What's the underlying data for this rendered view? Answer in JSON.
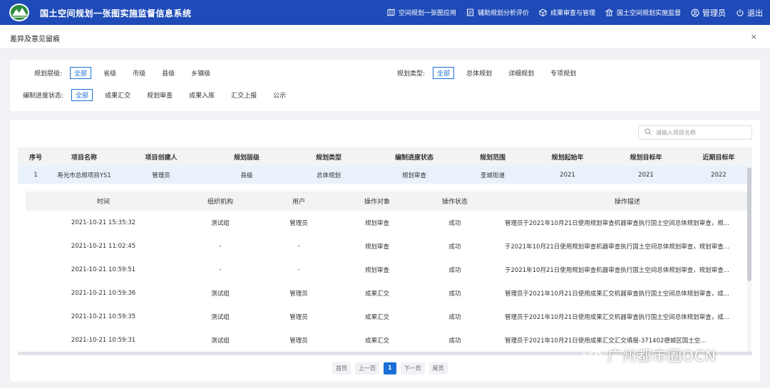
{
  "app": {
    "title": "国土空间规划一张图实施监督信息系统",
    "nav": [
      {
        "label": "空间规划一张图应用",
        "icon": "map-icon"
      },
      {
        "label": "辅助规划分析评价",
        "icon": "document-icon"
      },
      {
        "label": "成果审查与管理",
        "icon": "cube-icon"
      },
      {
        "label": "国土空间规划实施监督",
        "icon": "bank-icon"
      }
    ],
    "user_label": "管理员",
    "logout_label": "退出"
  },
  "panel": {
    "title": "差异及意见留痕",
    "close_label": "×"
  },
  "filters": {
    "level_label": "规划层级:",
    "level_options": [
      "全部",
      "省级",
      "市级",
      "县级",
      "乡镇级"
    ],
    "type_label": "规划类型:",
    "type_options": [
      "全部",
      "总体规划",
      "详细规划",
      "专项规划"
    ],
    "progress_label": "编制进度状态:",
    "progress_options": [
      "全部",
      "成果汇交",
      "规划审查",
      "成果入库",
      "汇交上报",
      "公示"
    ]
  },
  "search": {
    "placeholder": "请输入项目名称"
  },
  "main_table": {
    "columns": [
      "序号",
      "项目名称",
      "项目创建人",
      "规划层级",
      "规划类型",
      "编制进度状态",
      "规划范围",
      "规划起始年",
      "规划目标年",
      "近期目标年"
    ],
    "rows": [
      [
        "1",
        "寿光市总规项目YS1",
        "管理员",
        "县级",
        "总体规划",
        "规划审查",
        "圣城街道",
        "2021",
        "2021",
        "2022"
      ]
    ]
  },
  "sub_table": {
    "columns": [
      "时间",
      "组织机构",
      "用户",
      "操作对象",
      "操作状态",
      "操作描述"
    ],
    "rows": [
      [
        "2021-10-21 15:35:32",
        "测试组",
        "管理员",
        "规划审查",
        "成功",
        "管理员于2021年10月21日使用规划审查机器审查执行国土空间总体规划审查，规..."
      ],
      [
        "2021-10-21 11:02:45",
        "-",
        "-",
        "规划审查",
        "成功",
        "于2021年10月21日使用规划审查机器审查执行国土空间总体规划审查，规划审查..."
      ],
      [
        "2021-10-21 10:59:51",
        "-",
        "-",
        "规划审查",
        "成功",
        "于2021年10月21日使用规划审查机器审查执行国土空间总体规划审查，规划审查..."
      ],
      [
        "2021-10-21 10:59:36",
        "测试组",
        "管理员",
        "成果汇交",
        "成功",
        "管理员于2021年10月21日使用成果汇交机器审查执行国土空间总体规划审查，成..."
      ],
      [
        "2021-10-21 10:59:35",
        "测试组",
        "管理员",
        "成果汇交",
        "成功",
        "管理员于2021年10月21日使用成果汇交机器审查执行国土空间总体规划审查，成..."
      ],
      [
        "2021-10-21 10:59:31",
        "测试组",
        "管理员",
        "成果汇交",
        "成功",
        "管理员于2021年10月21日使用成果汇交汇交填报-371402德城区国土空..."
      ]
    ]
  },
  "pagination": {
    "first": "首页",
    "prev": "上一页",
    "current": "1",
    "next": "下一页",
    "last": "尾页"
  },
  "watermark": {
    "wechat_label": "广州都市圈OCN"
  },
  "colors": {
    "header_bg": "#1f4bb8",
    "accent": "#1a6fd8",
    "row_selected": "#e9f1fb"
  }
}
